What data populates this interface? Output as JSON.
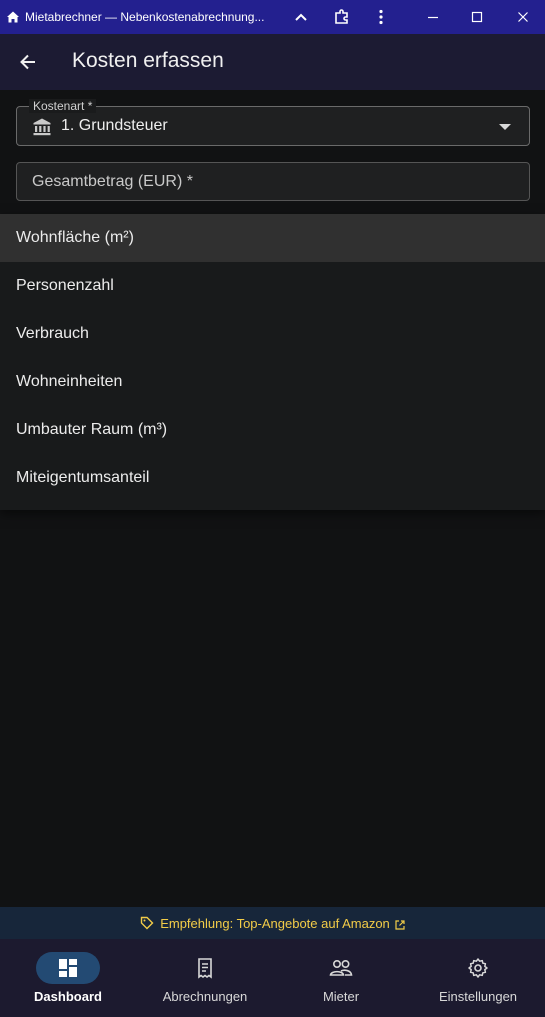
{
  "window": {
    "title": "Mietabrechner — Nebenkostenabrechnung..."
  },
  "appbar": {
    "title": "Kosten erfassen"
  },
  "form": {
    "cost_type": {
      "label": "Kostenart *",
      "value": "1. Grundsteuer",
      "icon": "bank-icon"
    },
    "total_amount": {
      "placeholder": "Gesamtbetrag (EUR) *",
      "value": ""
    }
  },
  "menu": {
    "items": [
      {
        "label": "Wohnfläche (m²)",
        "selected": true
      },
      {
        "label": "Personenzahl",
        "selected": false
      },
      {
        "label": "Verbrauch",
        "selected": false
      },
      {
        "label": "Wohneinheiten",
        "selected": false
      },
      {
        "label": "Umbauter Raum (m³)",
        "selected": false
      },
      {
        "label": "Miteigentumsanteil",
        "selected": false
      }
    ]
  },
  "promo": {
    "text": "Empfehlung: Top-Angebote auf Amazon"
  },
  "bottom_nav": {
    "items": [
      {
        "label": "Dashboard",
        "icon": "dashboard-icon",
        "active": true
      },
      {
        "label": "Abrechnungen",
        "icon": "receipt-icon",
        "active": false
      },
      {
        "label": "Mieter",
        "icon": "people-icon",
        "active": false
      },
      {
        "label": "Einstellungen",
        "icon": "gear-icon",
        "active": false
      }
    ]
  },
  "colors": {
    "titlebar": "#23208f",
    "appbar": "#1c1b33",
    "background": "#111213",
    "promo_text": "#f2cc48",
    "nav_active_pill": "#234a73"
  }
}
